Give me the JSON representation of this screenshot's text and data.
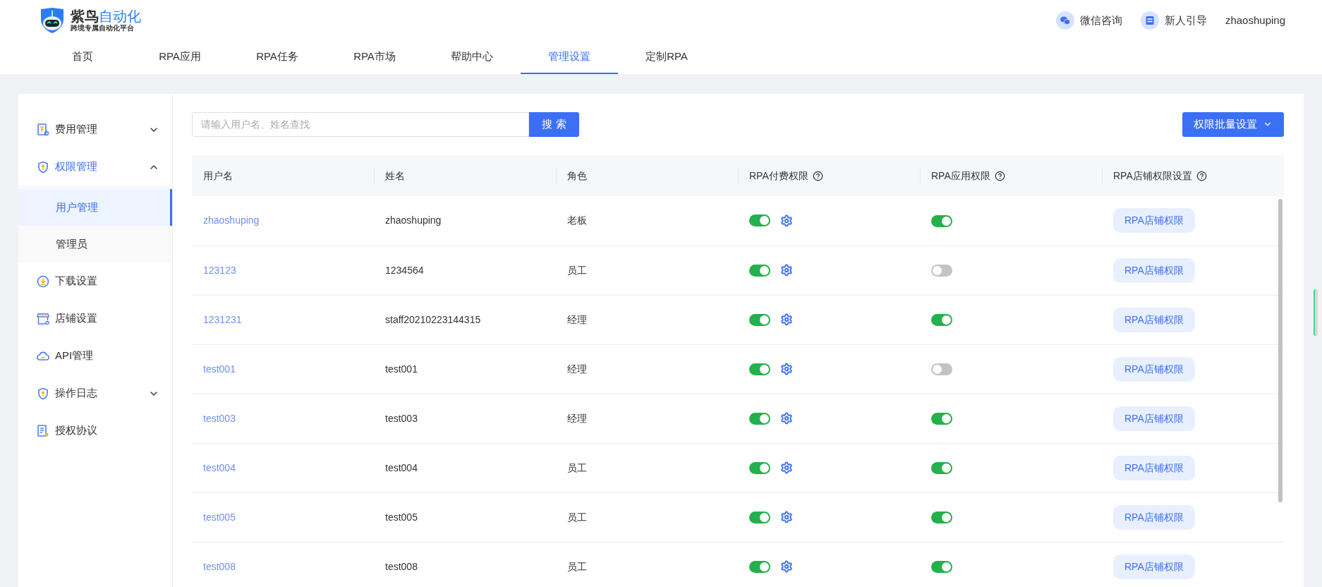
{
  "brand": {
    "name_dark": "紫鸟",
    "name_accent": "自动化",
    "tagline": "跨境专属自动化平台"
  },
  "header_links": [
    {
      "kind": "wechat",
      "label": "微信咨询"
    },
    {
      "kind": "guide",
      "label": "新人引导"
    },
    {
      "kind": "user",
      "label": "zhaoshuping"
    }
  ],
  "nav": [
    {
      "label": "首页",
      "selected": false
    },
    {
      "label": "RPA应用",
      "selected": false
    },
    {
      "label": "RPA任务",
      "selected": false
    },
    {
      "label": "RPA市场",
      "selected": false
    },
    {
      "label": "帮助中心",
      "selected": false
    },
    {
      "label": "管理设置",
      "selected": true
    },
    {
      "label": "定制RPA",
      "selected": false
    }
  ],
  "sidebar": [
    {
      "kind": "fee",
      "label": "费用管理",
      "expanded": false,
      "selected": false
    },
    {
      "kind": "shield",
      "label": "权限管理",
      "expanded": true,
      "selected": true,
      "children": [
        {
          "label": "用户管理",
          "selected": true
        },
        {
          "label": "管理员",
          "selected": false
        }
      ]
    },
    {
      "kind": "download",
      "label": "下载设置",
      "selected": false
    },
    {
      "kind": "store",
      "label": "店铺设置",
      "selected": false
    },
    {
      "kind": "cloud",
      "label": "API管理",
      "selected": false
    },
    {
      "kind": "shield",
      "label": "操作日志",
      "expanded": false,
      "selected": false
    },
    {
      "kind": "doc",
      "label": "授权协议",
      "selected": false
    }
  ],
  "search": {
    "placeholder": "请输入用户名、姓名查找",
    "button": "搜 索"
  },
  "batch_button": "权限批量设置",
  "table": {
    "columns": [
      {
        "label": "用户名",
        "help": false
      },
      {
        "label": "姓名",
        "help": false
      },
      {
        "label": "角色",
        "help": false
      },
      {
        "label": "RPA付费权限",
        "help": true
      },
      {
        "label": "RPA应用权限",
        "help": true
      },
      {
        "label": "RPA店铺权限设置",
        "help": true
      }
    ],
    "rows": [
      {
        "username": "zhaoshuping",
        "name": "zhaoshuping",
        "role": "老板",
        "paid": true,
        "app": true,
        "action": "RPA店铺权限"
      },
      {
        "username": "123123",
        "name": "1234564",
        "role": "员工",
        "paid": true,
        "app": false,
        "action": "RPA店铺权限"
      },
      {
        "username": "1231231",
        "name": "staff20210223144315",
        "role": "经理",
        "paid": true,
        "app": true,
        "action": "RPA店铺权限"
      },
      {
        "username": "test001",
        "name": "test001",
        "role": "经理",
        "paid": true,
        "app": false,
        "action": "RPA店铺权限"
      },
      {
        "username": "test003",
        "name": "test003",
        "role": "经理",
        "paid": true,
        "app": true,
        "action": "RPA店铺权限"
      },
      {
        "username": "test004",
        "name": "test004",
        "role": "员工",
        "paid": true,
        "app": true,
        "action": "RPA店铺权限"
      },
      {
        "username": "test005",
        "name": "test005",
        "role": "员工",
        "paid": true,
        "app": true,
        "action": "RPA店铺权限"
      },
      {
        "username": "test008",
        "name": "test008",
        "role": "员工",
        "paid": true,
        "app": true,
        "action": "RPA店铺权限"
      }
    ]
  }
}
